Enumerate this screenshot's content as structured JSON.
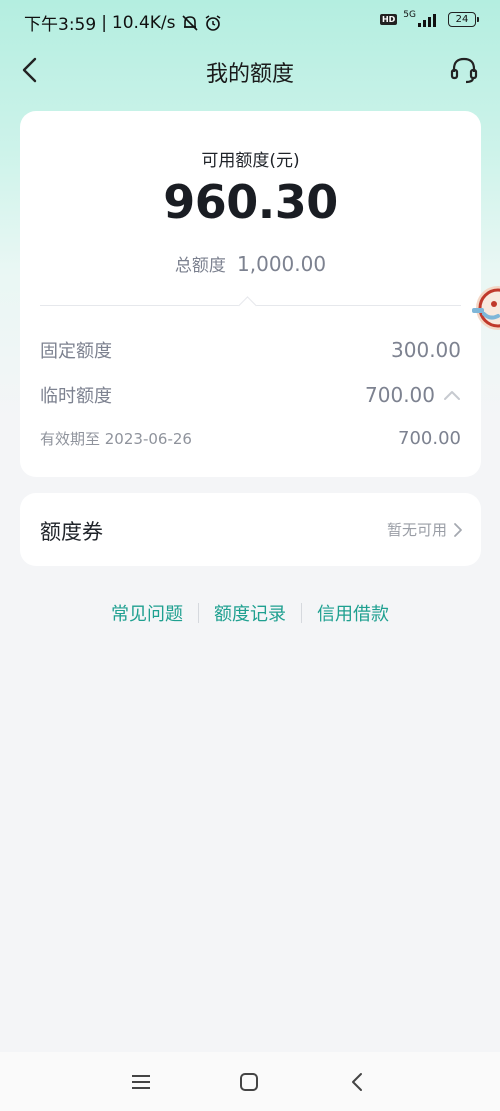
{
  "status_bar": {
    "time": "下午3:59",
    "separator": "|",
    "net_speed": "10.4K/s",
    "hd": "HD",
    "network": "5G",
    "battery": "24"
  },
  "nav": {
    "title": "我的额度"
  },
  "quota": {
    "available_label": "可用额度(元)",
    "available_value": "960.30",
    "total_label": "总额度",
    "total_value": "1,000.00",
    "fixed_label": "固定额度",
    "fixed_value": "300.00",
    "temp_label": "临时额度",
    "temp_value": "700.00",
    "expiry_label": "有效期至 2023-06-26",
    "expiry_value": "700.00"
  },
  "voucher": {
    "title": "额度券",
    "status": "暂无可用"
  },
  "links": [
    {
      "label": "常见问题"
    },
    {
      "label": "额度记录"
    },
    {
      "label": "信用借款"
    }
  ],
  "colors": {
    "accent": "#1fa090",
    "muted": "#7d8290",
    "header_bg": "#b4eee0"
  },
  "icons": {
    "back": "chevron-left-icon",
    "service": "headset-icon",
    "temp_toggle": "chevron-up-icon",
    "voucher_arrow": "chevron-right-icon",
    "bottom_menu": "menu-icon",
    "bottom_home": "home-square-icon",
    "bottom_back": "back-triangle-icon"
  }
}
